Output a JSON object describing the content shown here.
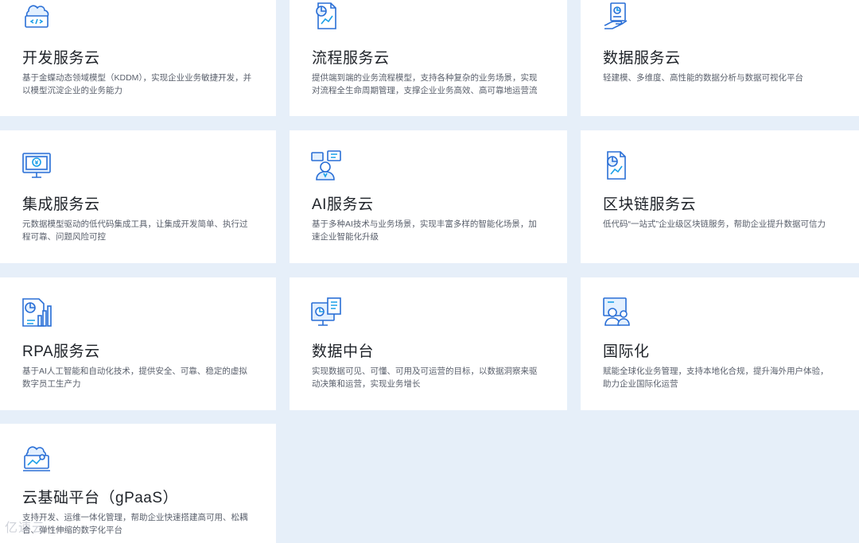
{
  "cards": [
    {
      "title": "开发服务云",
      "desc": "基于金蝶动态领域模型（KDDM），实现企业业务敏捷开发，并以模型沉淀企业的业务能力",
      "icon": "cloud-code-icon"
    },
    {
      "title": "流程服务云",
      "desc": "提供端到端的业务流程模型，支持各种复杂的业务场景，实现对流程全生命周期管理，支撑企业业务高效、高可靠地运营流",
      "icon": "process-chart-icon"
    },
    {
      "title": "数据服务云",
      "desc": "轻建模、多维度、高性能的数据分析与数据可视化平台",
      "icon": "data-hand-icon"
    },
    {
      "title": "集成服务云",
      "desc": "元数据模型驱动的低代码集成工具，让集成开发简单、执行过程可靠、问题风险可控",
      "icon": "monitor-yen-icon"
    },
    {
      "title": "AI服务云",
      "desc": "基于多种AI技术与业务场景，实现丰富多样的智能化场景，加速企业智能化升级",
      "icon": "ai-person-icon"
    },
    {
      "title": "区块链服务云",
      "desc": "低代码“一站式”企业级区块链服务，帮助企业提升数据可信力",
      "icon": "blockchain-doc-icon"
    },
    {
      "title": "RPA服务云",
      "desc": "基于AI人工智能和自动化技术，提供安全、可靠、稳定的虚拟数字员工生产力",
      "icon": "rpa-chart-icon"
    },
    {
      "title": "数据中台",
      "desc": "实现数据可见、可懂、可用及可运营的目标，以数据洞察来驱动决策和运营，实现业务增长",
      "icon": "data-platform-icon"
    },
    {
      "title": "国际化",
      "desc": "赋能全球化业务管理，支持本地化合规，提升海外用户体验，助力企业国际化运营",
      "icon": "global-users-icon"
    },
    {
      "title": "云基础平台（gPaaS）",
      "desc": "支持开发、运维一体化管理，帮助企业快速搭建高可用、松耦合、弹性伸缩的数字化平台",
      "icon": "cloud-platform-icon"
    }
  ],
  "watermark": "亿速云"
}
